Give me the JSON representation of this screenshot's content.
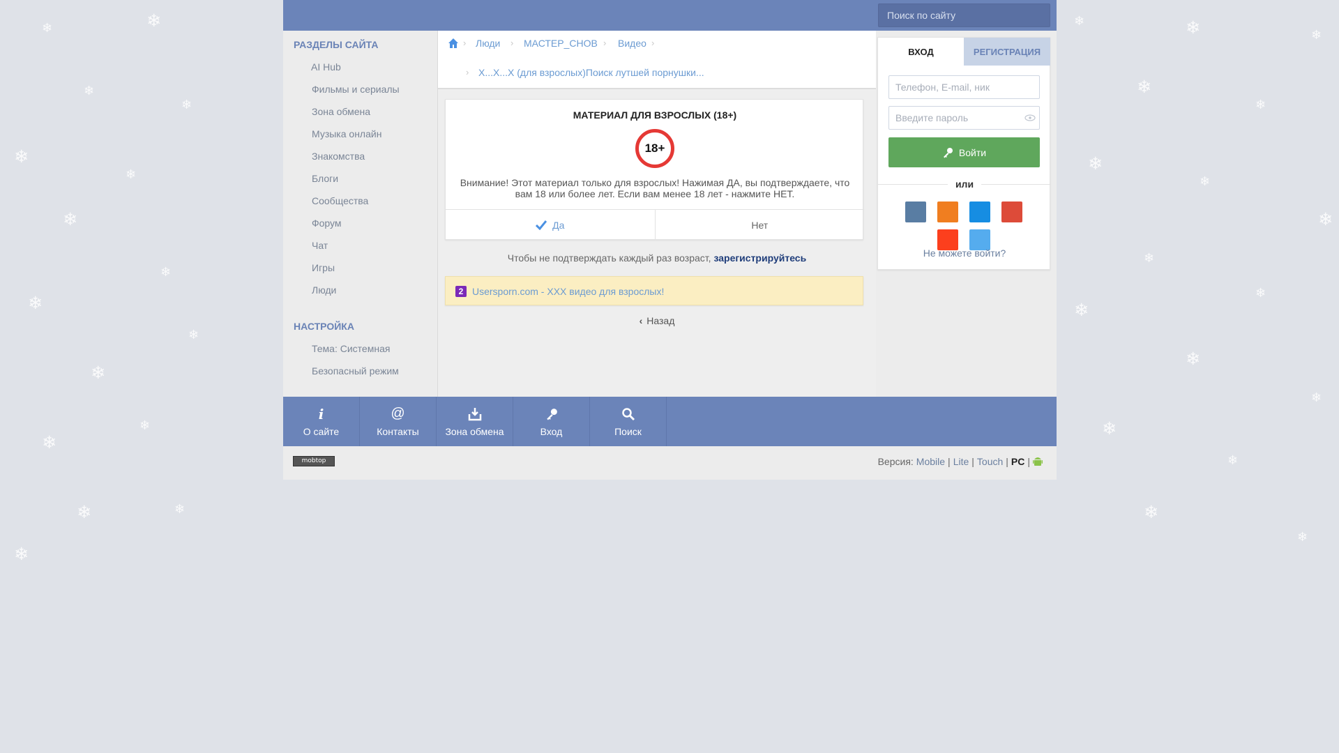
{
  "header": {
    "search_placeholder": "Поиск по сайту"
  },
  "sidebar": {
    "sections_title": "РАЗДЕЛЫ САЙТА",
    "items": [
      {
        "label": "AI Hub"
      },
      {
        "label": "Фильмы и сериалы"
      },
      {
        "label": "Зона обмена"
      },
      {
        "label": "Музыка онлайн"
      },
      {
        "label": "Знакомства"
      },
      {
        "label": "Блоги"
      },
      {
        "label": "Сообщества"
      },
      {
        "label": "Форум"
      },
      {
        "label": "Чат"
      },
      {
        "label": "Игры"
      },
      {
        "label": "Люди"
      }
    ],
    "settings_title": "НАСТРОЙКА",
    "settings": [
      {
        "label": "Тема: Системная"
      },
      {
        "label": "Безопасный режим"
      }
    ]
  },
  "breadcrumb": {
    "items": [
      "Люди",
      "МАСТЕР_СНОВ",
      "Видео"
    ],
    "current": "X...X...X (для взрослых)Поиск лутшей порнушки..."
  },
  "adult_card": {
    "title": "МАТЕРИАЛ ДЛЯ ВЗРОСЛЫХ (18+)",
    "badge": "18+",
    "warning": "Внимание! Этот материал только для взрослых! Нажимая ДА, вы подтверждаете, что вам 18 или более лет. Если вам менее 18 лет - нажмите НЕТ.",
    "yes_label": "Да",
    "no_label": "Нет"
  },
  "confirm_note": {
    "text": "Чтобы не подтверждать каждый раз возраст,",
    "link": "зарегистрируйтесь"
  },
  "ad": {
    "icon_char": "2",
    "text": "Usersporn.com - XXX видео для взрослых!"
  },
  "back_label": "Назад",
  "login": {
    "tab_login": "ВХОД",
    "tab_register": "РЕГИСТРАЦИЯ",
    "login_placeholder": "Телефон, E-mail, ник",
    "password_placeholder": "Введите пароль",
    "submit_label": "Войти",
    "or_label": "или",
    "forgot_label": "Не можете войти?",
    "social": [
      {
        "name": "vk",
        "color": "#597da3"
      },
      {
        "name": "odnoklassniki",
        "color": "#f07e20"
      },
      {
        "name": "mailru",
        "color": "#168de2"
      },
      {
        "name": "google",
        "color": "#dd4b39"
      },
      {
        "name": "yandex",
        "color": "#fc3f1d"
      },
      {
        "name": "twitter",
        "color": "#55acee"
      }
    ]
  },
  "bottom_nav": [
    {
      "label": "О сайте",
      "icon": "info-icon"
    },
    {
      "label": "Контакты",
      "icon": "at-icon"
    },
    {
      "label": "Зона обмена",
      "icon": "download-icon"
    },
    {
      "label": "Вход",
      "icon": "key-icon"
    },
    {
      "label": "Поиск",
      "icon": "search-icon"
    }
  ],
  "footer": {
    "counter_label": "mobtop",
    "version_prefix": "Версия:",
    "versions": [
      "Mobile",
      "Lite",
      "Touch",
      "PC"
    ],
    "active_version": "PC"
  },
  "colors": {
    "header_bg": "#6b84b9",
    "link": "#6b9bd2",
    "login_button": "#5fa75c",
    "badge_ring": "#e53935"
  }
}
